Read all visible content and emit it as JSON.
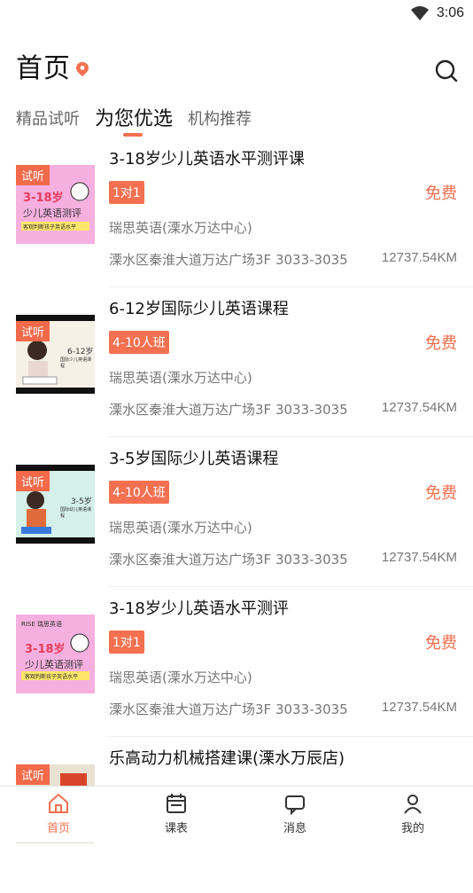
{
  "status": {
    "time": "3:06"
  },
  "header": {
    "title": "首页"
  },
  "tabs": [
    {
      "label": "精品试听"
    },
    {
      "label": "为您优选"
    },
    {
      "label": "机构推荐"
    }
  ],
  "items": [
    {
      "thumb_badge": "试听",
      "title": "3-18岁少儿英语水平测评课",
      "tag": "1对1",
      "price": "免费",
      "org": "瑞思英语(溧水万达中心)",
      "address": "溧水区秦淮大道万达广场3F 3033-3035",
      "distance": "12737.54KM",
      "thumb_text": "3-18岁",
      "thumb_sub": "少儿英语测评",
      "thumb_caption": "客观判断孩子英语水平"
    },
    {
      "thumb_badge": "试听",
      "title": "6-12岁国际少儿英语课程",
      "tag": "4-10人班",
      "price": "免费",
      "org": "瑞思英语(溧水万达中心)",
      "address": "溧水区秦淮大道万达广场3F 3033-3035",
      "distance": "12737.54KM",
      "thumb_text": "6-12岁",
      "thumb_sub": "国际少儿英语课程"
    },
    {
      "thumb_badge": "试听",
      "title": "3-5岁国际少儿英语课程",
      "tag": "4-10人班",
      "price": "免费",
      "org": "瑞思英语(溧水万达中心)",
      "address": "溧水区秦淮大道万达广场3F 3033-3035",
      "distance": "12737.54KM",
      "thumb_text": "3-5岁",
      "thumb_sub": "国际幼儿英语课程"
    },
    {
      "thumb_badge": "",
      "title": "3-18岁少儿英语水平测评",
      "tag": "1对1",
      "price": "免费",
      "org": "瑞思英语(溧水万达中心)",
      "address": "溧水区秦淮大道万达广场3F 3033-3035",
      "distance": "12737.54KM",
      "thumb_text": "3-18岁",
      "thumb_sub": "少儿英语测评",
      "thumb_caption": "客观判断孩子英语水平",
      "thumb_logo": "RISE 瑞思英语"
    },
    {
      "thumb_badge": "试听",
      "title": "乐高动力机械搭建课(溧水万辰店)"
    }
  ],
  "bottom_nav": [
    {
      "label": "首页",
      "icon": "home-icon"
    },
    {
      "label": "课表",
      "icon": "calendar-icon"
    },
    {
      "label": "消息",
      "icon": "message-icon"
    },
    {
      "label": "我的",
      "icon": "user-icon"
    }
  ],
  "colors": {
    "accent": "#f47050",
    "thumb_pink": "#f3a3d8",
    "thumb_mint": "#cdeee6"
  }
}
